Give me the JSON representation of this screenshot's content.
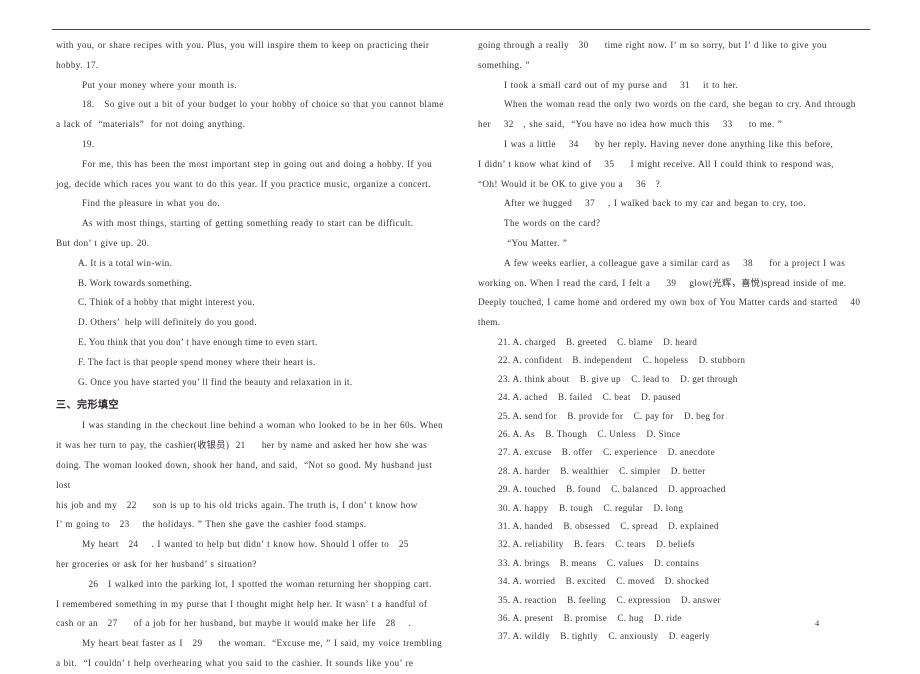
{
  "document": {
    "page_number": "4",
    "section_heading": "三、完形填空"
  },
  "left_column": {
    "paragraphs": [
      "with you, or share recipes with you. Plus, you will inspire them to keep on practicing their",
      "hobby. 17.  ",
      "        Put your money where your mouth is.",
      "        18.   So give out a bit of your budget lo your hobby of choice so that you cannot blame",
      "a lack of  “materials”  for not doing anything.",
      "        19.  ",
      "        For me, this has been the most important step in going out and doing a hobby. If you",
      "jog, decide which races you want to do this year. If you practice music, organize a concert.",
      "        Find the pleasure in what you do.",
      "        As with most things, starting of getting something ready to start can be difficult.",
      "But don’ t give up. 20.  "
    ],
    "options": [
      "A. It is a total win-win.",
      "B. Work towards something.",
      "C. Think of a hobby that might interest you.",
      "D. Others’  help will definitely do you good.",
      "E. You think that you don’ t have enough time to even start.",
      "F. The fact is that people spend money where their heart is.",
      "G. Once you have started you’ ll find the beauty and relaxation in it."
    ],
    "cloze_paragraphs": [
      "        I was standing in the checkout line behind a woman who looked to be in her 60s. When",
      "it was her turn to pay, the cashier(收银员)  21     her by name and asked her how she was",
      "doing. The woman looked down, shook her hand, and said,  “Not so good. My husband just lost",
      "his job and my   22     son is up to his old tricks again. The truth is, I don’ t know how",
      "I’ m going to   23    the holidays. ” Then she gave the cashier food stamps.",
      "        My heart   24    . I wanted to help but didn’ t know how. Should I offer to   25    ",
      "her groceries or ask for her husband’ s situation?",
      "          26   I walked into the parking lot, I spotted the woman returning her shopping cart.",
      "I remembered something in my purse that I thought might help her. It wasn’ t a handful of",
      "cash or an   27     of a job for her husband, but maybe it would make her life   28    .",
      "        My heart beat faster as I   29     the woman.  “Excuse me, ” I said, my voice trembling",
      "a bit.  “I couldn’ t help overhearing what you said to the cashier. It sounds like you’ re"
    ]
  },
  "right_column": {
    "paragraphs": [
      "going through a really   30     time right now. I’ m so sorry, but I’ d like to give you",
      "something. ”",
      "        I took a small card out of my purse and    31    it to her.",
      "        When the woman read the only two words on the card, she began to cry. And through",
      "her    32   , she said,  “You have no idea how much this    33     to me. ”",
      "        I was a little    34     by her reply. Having never done anything like this before,",
      "I didn’ t know what kind of    35     I might receive. All I could think to respond was,",
      "“Oh! Would it be OK to give you a    36   ?",
      "        After we hugged    37    , I walked back to my car and began to cry, too.",
      "        The words on the card?",
      "         “You Matter. ”",
      "        A few weeks earlier, a colleague gave a similar card as    38     for a project I was",
      "working on. When I read the card, I felt a     39    glow(光辉，喜悦)spread inside of me.",
      "Deeply touched, I came home and ordered my own box of You Matter cards and started    40   ",
      "them."
    ],
    "questions": [
      "21. A. charged    B. greeted    C. blame    D. heard",
      "22. A. confident    B. independent    C. hopeless    D. stubborn",
      "23. A. think about    B. give up    C. lead to    D. get through",
      "24. A. ached    B. failed    C. beat    D. paused",
      "25. A. send for    B. provide for    C. pay for    D. beg for",
      "26. A. As    B. Though    C. Unless    D. Since",
      "27. A. excuse    B. offer    C. experience    D. anecdote",
      "28. A. harder    B. wealthier    C. simpler    D. better",
      "29. A. touched    B. found    C. balanced    D. approached",
      "30. A. happy    B. tough    C. regular    D. long",
      "31. A. handed    B. obsessed    C. spread    D. explained",
      "32. A. reliability    B. fears    C. tears    D. beliefs",
      "33. A. brings    B. means    C. values    D. contains",
      "34. A. worried    B. excited    C. moved    D. shocked",
      "35. A. reaction    B. feeling    C. expression    D. answer",
      "36. A. present    B. promise    C. hug    D. ride",
      "37. A. wildly    B. tightly    C. anxiously    D. eagerly"
    ]
  }
}
